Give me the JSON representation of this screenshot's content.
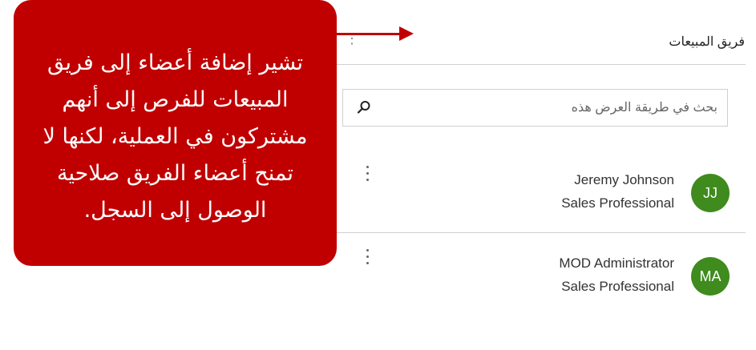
{
  "panel": {
    "title": "فريق المبيعات",
    "more_icon": "more-vertical-icon"
  },
  "search": {
    "placeholder": "بحث في طريقة العرض هذه",
    "icon": "search-icon"
  },
  "members": [
    {
      "initials": "JJ",
      "name": "Jeremy Johnson",
      "role": "Sales Professional",
      "avatar_color": "#3f8b1e"
    },
    {
      "initials": "MA",
      "name": "MOD Administrator",
      "role": "Sales Professional",
      "avatar_color": "#3f8b1e"
    }
  ],
  "callout": {
    "text": "تشير إضافة أعضاء إلى فريق المبيعات للفرص إلى أنهم مشتركون في العملية، لكنها لا تمنح أعضاء الفريق صلاحية الوصول إلى السجل.",
    "color": "#c00000"
  }
}
